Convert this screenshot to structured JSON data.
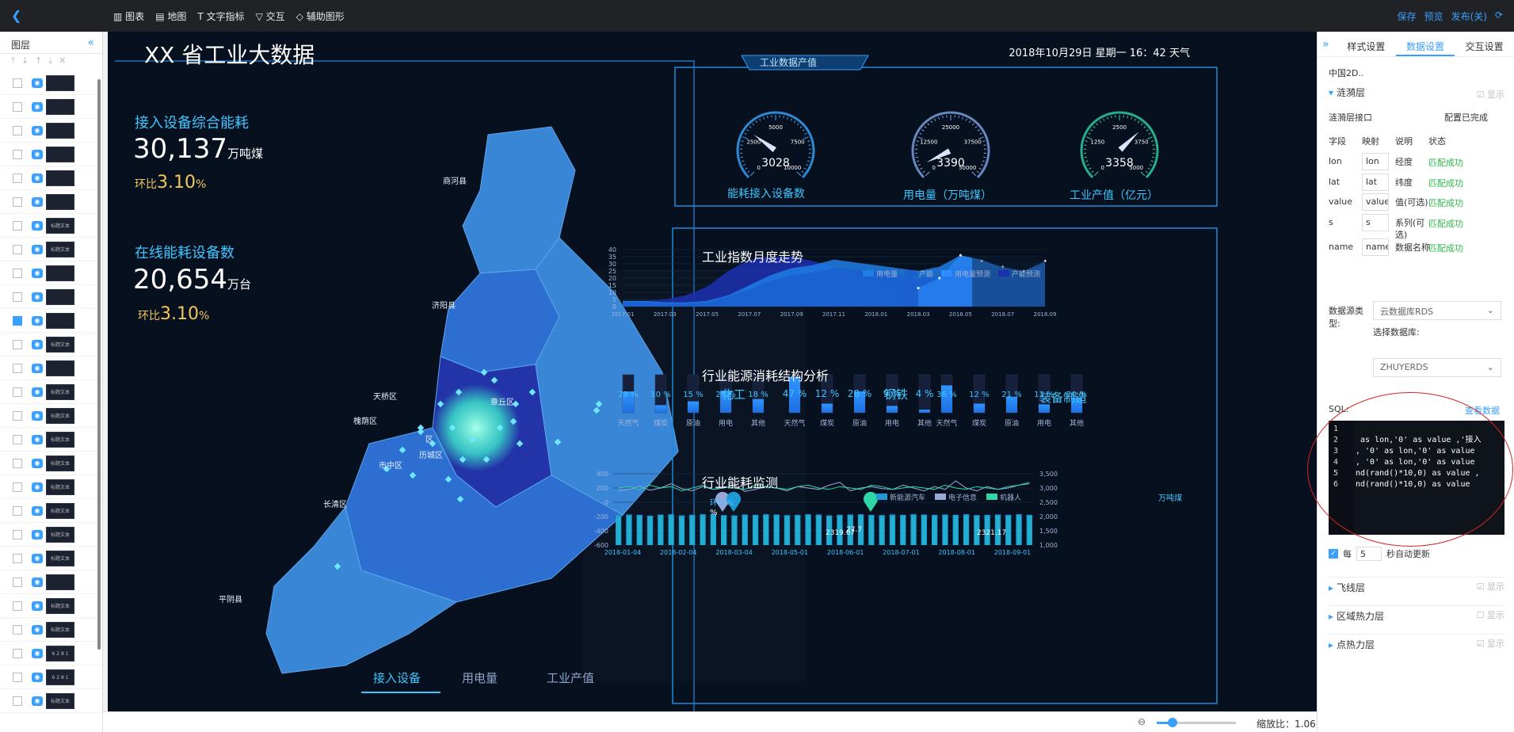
{
  "topbar": {
    "back_icon": "back-chevron",
    "tools": [
      "图表",
      "地图",
      "文字指标",
      "交互",
      "辅助图形"
    ],
    "actions": [
      "保存",
      "预览",
      "发布(关)"
    ]
  },
  "layers": {
    "title": "图层",
    "rows": [
      {
        "checked": false,
        "thumb": ""
      },
      {
        "checked": false,
        "thumb": ""
      },
      {
        "checked": false,
        "thumb": ""
      },
      {
        "checked": false,
        "thumb": ""
      },
      {
        "checked": false,
        "thumb": ""
      },
      {
        "checked": false,
        "thumb": ""
      },
      {
        "checked": false,
        "thumb": "标题文本"
      },
      {
        "checked": false,
        "thumb": "标题文本"
      },
      {
        "checked": false,
        "thumb": ""
      },
      {
        "checked": false,
        "thumb": ""
      },
      {
        "checked": true,
        "thumb": ""
      },
      {
        "checked": false,
        "thumb": "标题文本"
      },
      {
        "checked": false,
        "thumb": ""
      },
      {
        "checked": false,
        "thumb": "标题文本"
      },
      {
        "checked": false,
        "thumb": "标题文本"
      },
      {
        "checked": false,
        "thumb": "标题文本"
      },
      {
        "checked": false,
        "thumb": "标题文本"
      },
      {
        "checked": false,
        "thumb": "标题文本"
      },
      {
        "checked": false,
        "thumb": "标题文本"
      },
      {
        "checked": false,
        "thumb": "标题文本"
      },
      {
        "checked": false,
        "thumb": "标题文本"
      },
      {
        "checked": false,
        "thumb": ""
      },
      {
        "checked": false,
        "thumb": "标题文本"
      },
      {
        "checked": false,
        "thumb": "标题文本"
      },
      {
        "checked": false,
        "thumb": "6 2 8 1"
      },
      {
        "checked": false,
        "thumb": "6 2 8 1"
      },
      {
        "checked": false,
        "thumb": "标题文本"
      }
    ]
  },
  "dashboard": {
    "title": "XX 省工业大数据",
    "datetime": "2018年10月29日 星期一 16：42",
    "weather": "天气",
    "kpi1": {
      "label": "接入设备综合能耗",
      "value": "30,137",
      "unit": "万吨煤",
      "ratio_label": "环比",
      "ratio": "3.10",
      "pct": "%"
    },
    "kpi2": {
      "label": "在线能耗设备数",
      "value": "20,654",
      "unit": "万台",
      "ratio_label": "环比",
      "ratio": "3.10",
      "pct": "%"
    },
    "map": {
      "regions": [
        "商河县",
        "济阳县",
        "天桥区",
        "槐荫区",
        "历城区",
        "市中区",
        "章丘区",
        "长清区",
        "平阴县"
      ],
      "region_extra_label": "区",
      "colors": {
        "light": "#3a86d6",
        "mid": "#2d6fd0",
        "dark": "#2234a8",
        "glow": "#5cffd8"
      }
    },
    "map_tabs": [
      "接入设备",
      "用电量",
      "工业产值"
    ],
    "production_title": "工业数据产值",
    "gauges": [
      {
        "name": "能耗接入设备数",
        "value": 3028,
        "max": 10000,
        "fraction": 0.3,
        "ticks": [
          "0",
          "2500",
          "5000",
          "7500",
          "10000"
        ],
        "color": "#3aa8ff"
      },
      {
        "name": "用电量（万吨煤）",
        "value": 3390,
        "max": 50000,
        "fraction": 0.07,
        "ticks": [
          "0",
          "12500",
          "25000",
          "37500",
          "50000"
        ],
        "color": "#7ea6e6"
      },
      {
        "name": "工业产值（亿元）",
        "value": 3358,
        "max": 5000,
        "fraction": 0.67,
        "ticks": [
          "0",
          "1250",
          "2500",
          "3750",
          "5000"
        ],
        "color": "#2fd6a6"
      }
    ],
    "trend": {
      "title": "工业指数月度走势",
      "legend": [
        "用电量",
        "产能",
        "用电量预测",
        "产能预测"
      ],
      "legend_colors": [
        "#1e7ee6",
        "#1a5fd0",
        "#2f8cff",
        "#1d2fb0"
      ]
    },
    "structure": {
      "title": "行业能源消耗结构分析",
      "groups": [
        {
          "name": "化工",
          "items": [
            {
              "pct": "28 %",
              "v": 28,
              "label": "天然气"
            },
            {
              "pct": "10 %",
              "v": 10,
              "label": "煤炭"
            },
            {
              "pct": "15 %",
              "v": 15,
              "label": "原油"
            },
            {
              "pct": "29 %",
              "v": 29,
              "label": "用电"
            },
            {
              "pct": "18 %",
              "v": 18,
              "label": "其他"
            }
          ]
        },
        {
          "name": "钢铁",
          "items": [
            {
              "pct": "47 %",
              "v": 47,
              "label": "天然气"
            },
            {
              "pct": "12 %",
              "v": 12,
              "label": "煤炭"
            },
            {
              "pct": "28 %",
              "v": 28,
              "label": "原油"
            },
            {
              "pct": "9 %",
              "v": 9,
              "label": "用电"
            },
            {
              "pct": "4 %",
              "v": 4,
              "label": "其他"
            }
          ]
        },
        {
          "name": "装备制造",
          "items": [
            {
              "pct": "36 %",
              "v": 36,
              "label": "天然气"
            },
            {
              "pct": "12 %",
              "v": 12,
              "label": "煤炭"
            },
            {
              "pct": "21 %",
              "v": 21,
              "label": "原油"
            },
            {
              "pct": "11 %",
              "v": 11,
              "label": "用电"
            },
            {
              "pct": "20 %",
              "v": 20,
              "label": "其他"
            }
          ]
        }
      ]
    },
    "monitor": {
      "title": "行业能耗监测",
      "yleft_label": "环比%",
      "yleft_unit": "%",
      "yright_label": "万吨煤",
      "legend": [
        "新能源汽车",
        "电子信息",
        "机器人"
      ],
      "legend_colors": [
        "#1e9ad6",
        "#9aa8d8",
        "#2fd6a6"
      ],
      "markers": [
        "2319.67",
        "27.7",
        "2321.17"
      ]
    }
  },
  "chart_data": [
    {
      "type": "area",
      "title": "工业指数月度走势",
      "x": [
        "2017.01",
        "2017.02",
        "2017.03",
        "2017.04",
        "2017.05",
        "2017.06",
        "2017.07",
        "2017.08",
        "2017.09",
        "2017.10",
        "2017.11",
        "2017.12",
        "2018.01",
        "2018.02",
        "2018.03",
        "2018.04",
        "2018.05",
        "2018.06",
        "2018.07",
        "2018.08",
        "2018.09"
      ],
      "x_ticks": [
        "2017.01",
        "2017.03",
        "2017.05",
        "2017.07",
        "2017.09",
        "2017.11",
        "2018.01",
        "2018.03",
        "2018.05",
        "2018.07",
        "2018.09"
      ],
      "ylim": [
        0,
        40
      ],
      "y_ticks": [
        "0",
        "5",
        "10",
        "15",
        "20",
        "25",
        "30",
        "35",
        "40"
      ],
      "series": [
        {
          "name": "用电量",
          "values": [
            4,
            4,
            3,
            3,
            4,
            8,
            15,
            22,
            27,
            29,
            33,
            31,
            29,
            27,
            25,
            28,
            36,
            33,
            27,
            25,
            31
          ]
        },
        {
          "name": "产能",
          "values": [
            3,
            3,
            2,
            2,
            3,
            7,
            12,
            18,
            22,
            24,
            27,
            26,
            24,
            22,
            20,
            22,
            29,
            27,
            22,
            20,
            24
          ]
        },
        {
          "name": "用电量预测",
          "values": [
            null,
            null,
            null,
            null,
            null,
            null,
            null,
            null,
            null,
            null,
            null,
            null,
            null,
            null,
            13,
            20,
            36,
            32,
            28,
            25,
            32
          ]
        },
        {
          "name": "产能预测",
          "values": [
            3,
            4,
            5,
            8,
            14,
            25,
            33,
            35,
            35,
            32,
            28,
            22,
            18,
            15,
            null,
            null,
            null,
            null,
            null,
            null,
            null
          ]
        }
      ]
    },
    {
      "type": "bar",
      "title": "行业能耗监测",
      "x_ticks": [
        "2018-01-04",
        "2018-02-04",
        "2018-03-04",
        "2018-05-01",
        "2018-06-01",
        "2018-07-01",
        "2018-08-01",
        "2018-09-01"
      ],
      "ylim_left": [
        -600,
        400
      ],
      "y_ticks_left": [
        "400",
        "200",
        "0",
        "-200",
        "-400",
        "-600"
      ],
      "ylim_right": [
        1000,
        3500
      ],
      "y_ticks_right": [
        "3,500",
        "3,000",
        "2,500",
        "2,000",
        "1,500",
        "1,000"
      ],
      "series": [
        {
          "name": "新能源汽车",
          "values": [
            2050,
            2070,
            2060,
            2030,
            2070,
            2080,
            2040,
            2060,
            2080,
            2090,
            2050,
            2040,
            2070,
            2060,
            2080,
            2070,
            2050,
            2060,
            2080,
            2070,
            2040,
            2060,
            2070,
            2080,
            2060,
            2050,
            2070,
            2060,
            2080,
            2070,
            2060,
            2070,
            2060,
            2080,
            2050,
            2060,
            2070,
            2060,
            2080,
            2060
          ]
        },
        {
          "name": "电子信息",
          "values": [
            2900,
            2950,
            3050,
            2920,
            3000,
            3150,
            2980,
            2900,
            3050,
            2950,
            3000,
            3100,
            2880,
            2950,
            3050,
            3000,
            2900,
            3050,
            3000,
            2950,
            3100,
            3200,
            2900,
            3000,
            3050,
            2980,
            2950,
            3100,
            3000,
            2900,
            3050,
            2950,
            3250,
            3000,
            2900,
            3050,
            2950,
            3000,
            3100,
            3150
          ]
        },
        {
          "name": "机器人",
          "values": [
            3000,
            3050,
            2950,
            3100,
            3000,
            3050,
            2900,
            3000,
            3100,
            2950,
            3050,
            3000,
            2950,
            3100,
            3050,
            3000,
            2950,
            3050,
            3100,
            3000,
            2950,
            3050,
            3000,
            2950,
            3100,
            3050,
            2950,
            3000,
            3050,
            3000,
            2950,
            3100,
            3000,
            2950,
            3050,
            3000,
            2950,
            3050,
            3100,
            3200
          ]
        }
      ]
    }
  ],
  "props": {
    "tabs": [
      "样式设置",
      "数据设置",
      "交互设置"
    ],
    "active_tab": 1,
    "component": "中国2D..",
    "section_main": {
      "title": "涟漪层",
      "show": "显示"
    },
    "interface": {
      "label": "涟漪层接口",
      "status": "配置已完成"
    },
    "table_headers": [
      "字段",
      "映射",
      "说明",
      "状态"
    ],
    "fields": [
      {
        "field": "lon",
        "map": "lon",
        "desc": "经度",
        "status": "匹配成功"
      },
      {
        "field": "lat",
        "map": "lat",
        "desc": "纬度",
        "status": "匹配成功"
      },
      {
        "field": "value",
        "map": "value",
        "desc": "值(可选)",
        "status": "匹配成功"
      },
      {
        "field": "s",
        "map": "s",
        "desc": "系列(可选)",
        "status": "匹配成功"
      },
      {
        "field": "name",
        "map": "name",
        "desc": "数据名称",
        "status": "匹配成功"
      }
    ],
    "datasource_label": "数据源类型:",
    "datasource_value": "云数据库RDS",
    "db_label": "选择数据库:",
    "db_value": "ZHUYERDS",
    "sql_label": "SQL:",
    "sql_link": "查看数据",
    "sql_lines": [
      "",
      " as lon,'0' as value ,'接入",
      ", '0' as lon,'0' as value",
      ", '0' as lon,'0' as value",
      "nd(rand()*10,0) as value ,",
      "nd(rand()*10,0) as value"
    ],
    "auto_update": {
      "prefix": "每",
      "value": "5",
      "suffix": "秒自动更新"
    },
    "other_sections": [
      {
        "title": "飞线层",
        "show": "显示"
      },
      {
        "title": "区域热力层",
        "show": "显示"
      },
      {
        "title": "点热力层",
        "show": "显示"
      }
    ]
  },
  "statusbar": {
    "zoom_label": "缩放比：1.06",
    "zoom_fraction": 0.2
  }
}
